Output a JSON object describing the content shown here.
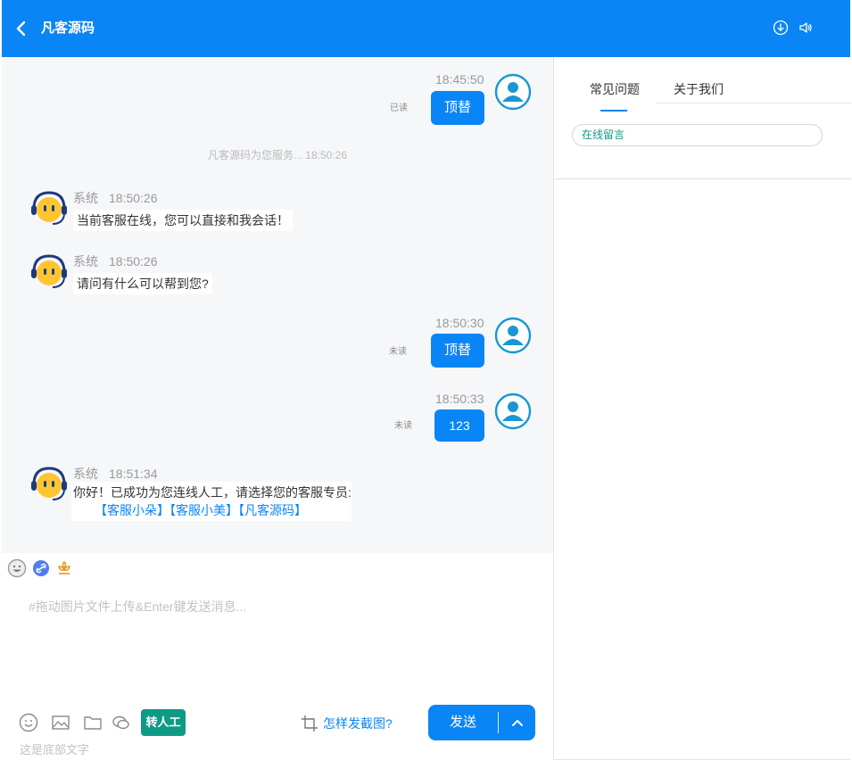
{
  "header": {
    "title": "凡客源码",
    "bg_color": "#0a85f5"
  },
  "chat": {
    "service_note": "凡客源码为您服务... 18:50:26",
    "messages": [
      {
        "side": "right",
        "time": "18:45:50",
        "status": "已读",
        "text": "顶替"
      },
      {
        "side": "left",
        "name": "系统",
        "time": "18:50:26",
        "text": "当前客服在线，您可以直接和我会话！"
      },
      {
        "side": "left",
        "name": "系统",
        "time": "18:50:26",
        "text": "请问有什么可以帮到您?"
      },
      {
        "side": "right",
        "time": "18:50:30",
        "status": "未读",
        "text": "顶替"
      },
      {
        "side": "right",
        "time": "18:50:33",
        "status": "未读",
        "text": "123"
      },
      {
        "side": "left",
        "name": "系统",
        "time": "18:51:34",
        "text": "你好！已成功为您连线人工，请选择您的客服专员:",
        "links": [
          "【客服小朵】",
          "【客服小美】",
          "【凡客源码】"
        ]
      }
    ]
  },
  "input": {
    "placeholder": "#拖动图片文件上传&Enter键发送消息...",
    "transfer_label": "转人工",
    "crop_label": "怎样发截图?",
    "send_label": "发送",
    "footer_text": "这是底部文字"
  },
  "right_panel": {
    "tabs": [
      "常见问题",
      "关于我们"
    ],
    "active_tab": "常见问题",
    "chip_label": "在线留言"
  },
  "colors": {
    "accent": "#0a85f5",
    "teal": "#0f9a85"
  }
}
